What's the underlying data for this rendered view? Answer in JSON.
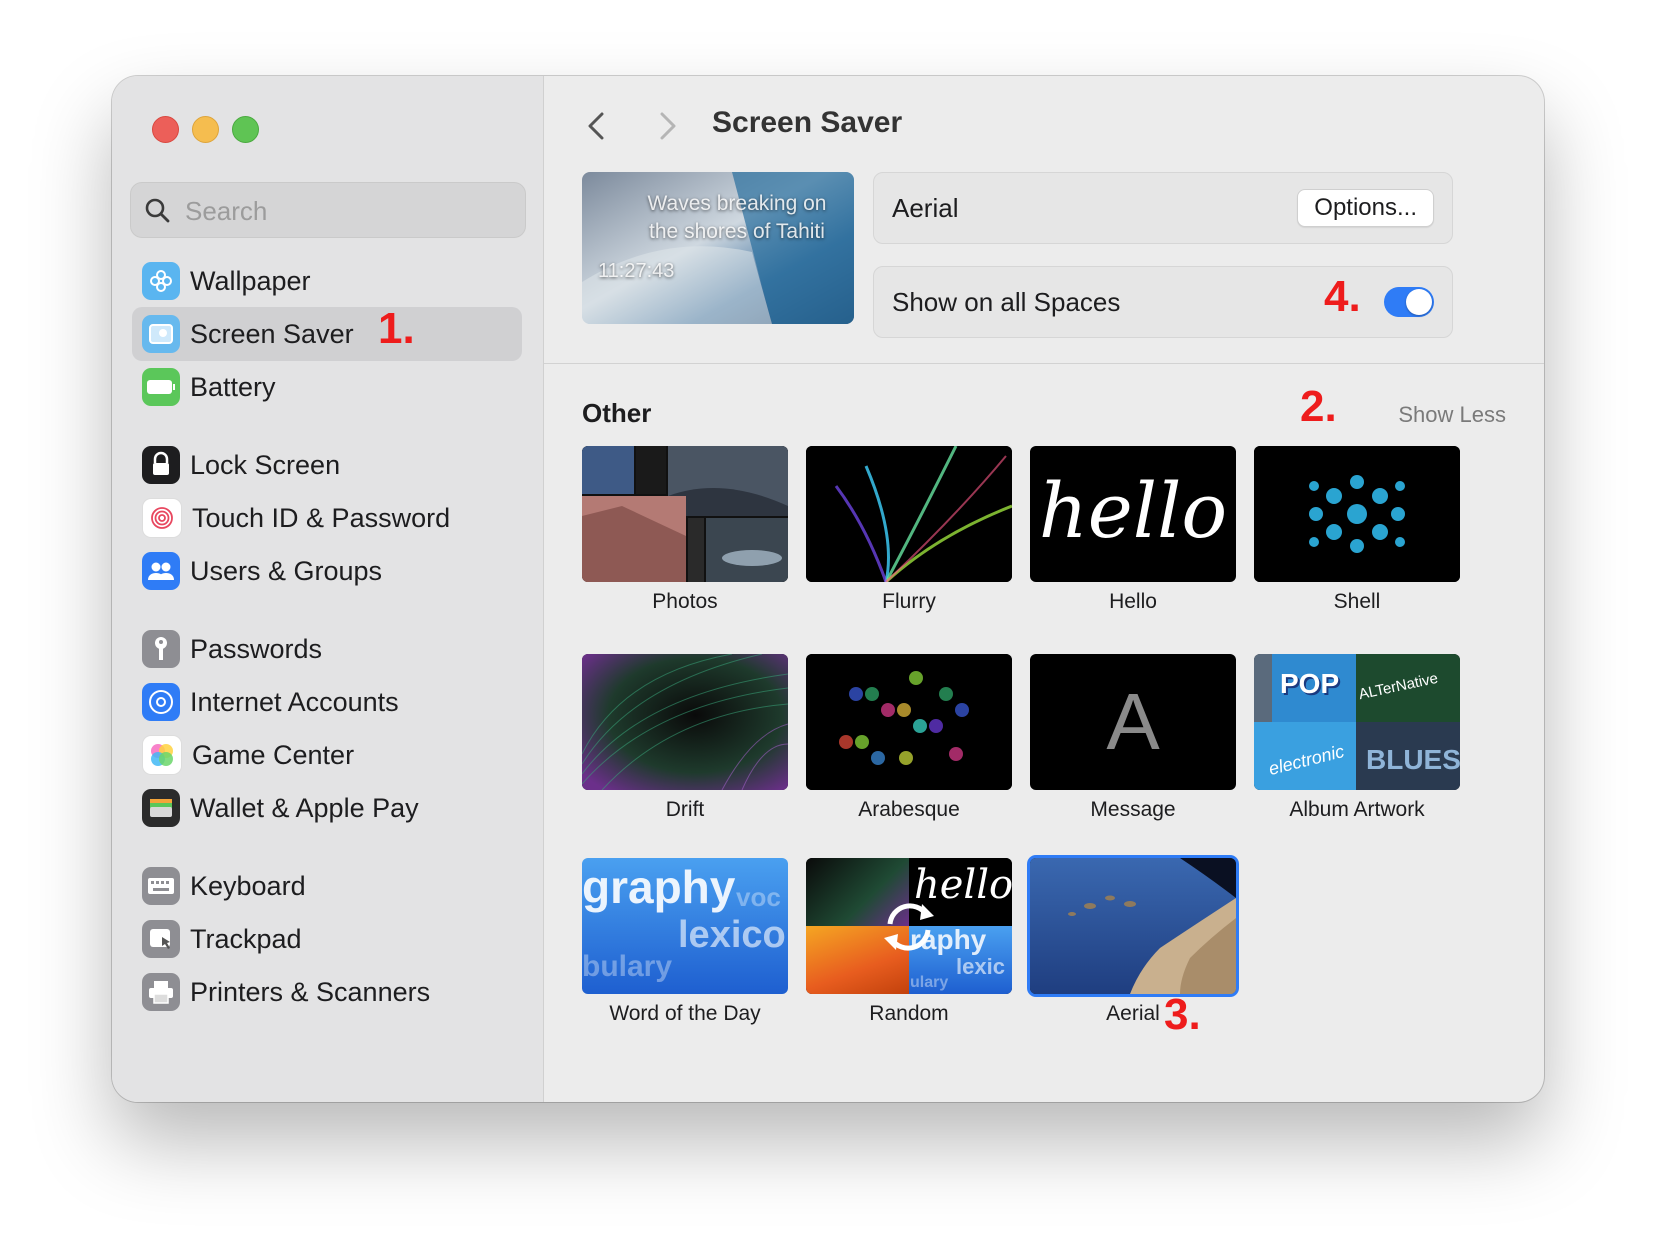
{
  "sidebar": {
    "search_placeholder": "Search",
    "items": [
      {
        "label": "Wallpaper",
        "icon": "wallpaper-icon",
        "color": "#5ab5f0"
      },
      {
        "label": "Screen Saver",
        "icon": "screen-saver-icon",
        "color": "#67b9ee",
        "selected": true
      },
      {
        "label": "Battery",
        "icon": "battery-icon",
        "color": "#5bc75a"
      },
      {
        "label": "Lock Screen",
        "icon": "lock-icon",
        "color": "#1d1d1f"
      },
      {
        "label": "Touch ID & Password",
        "icon": "fingerprint-icon",
        "color": "#ffffff"
      },
      {
        "label": "Users & Groups",
        "icon": "users-icon",
        "color": "#2f7cf6"
      },
      {
        "label": "Passwords",
        "icon": "key-icon",
        "color": "#8e8e93"
      },
      {
        "label": "Internet Accounts",
        "icon": "at-icon",
        "color": "#2f7cf6"
      },
      {
        "label": "Game Center",
        "icon": "game-center-icon",
        "color": "#ffffff"
      },
      {
        "label": "Wallet & Apple Pay",
        "icon": "wallet-icon",
        "color": "#2b2b2b"
      },
      {
        "label": "Keyboard",
        "icon": "keyboard-icon",
        "color": "#8e8e93"
      },
      {
        "label": "Trackpad",
        "icon": "trackpad-icon",
        "color": "#8e8e93"
      },
      {
        "label": "Printers & Scanners",
        "icon": "printer-icon",
        "color": "#8e8e93"
      }
    ]
  },
  "annotations": {
    "a1": "1.",
    "a2": "2.",
    "a3": "3.",
    "a4": "4."
  },
  "main": {
    "title": "Screen Saver",
    "preview": {
      "caption": "Waves breaking on the shores of Tahiti",
      "time": "11:27:43"
    },
    "current_saver": "Aerial",
    "options_label": "Options...",
    "show_all_spaces_label": "Show on all Spaces",
    "show_all_spaces_on": true,
    "section_title": "Other",
    "show_less_label": "Show Less",
    "savers": [
      {
        "label": "Photos"
      },
      {
        "label": "Flurry"
      },
      {
        "label": "Hello"
      },
      {
        "label": "Shell"
      },
      {
        "label": "Drift"
      },
      {
        "label": "Arabesque"
      },
      {
        "label": "Message"
      },
      {
        "label": "Album Artwork"
      },
      {
        "label": "Word of the Day"
      },
      {
        "label": "Random"
      },
      {
        "label": "Aerial",
        "selected": true
      }
    ],
    "thumb_text": {
      "hello": "hello",
      "message": "A",
      "pop": "POP",
      "alternative": "ALTerNative",
      "electronic": "electronic",
      "blues": "BLUES",
      "wotd_1": "graphy",
      "wotd_2": "voc",
      "wotd_3": "lexico",
      "wotd_4": "bulary",
      "random_hello": "hello",
      "random_1": "raphy",
      "random_2": "lexic",
      "random_3": "ulary"
    }
  },
  "accent": "#2f7cf6"
}
